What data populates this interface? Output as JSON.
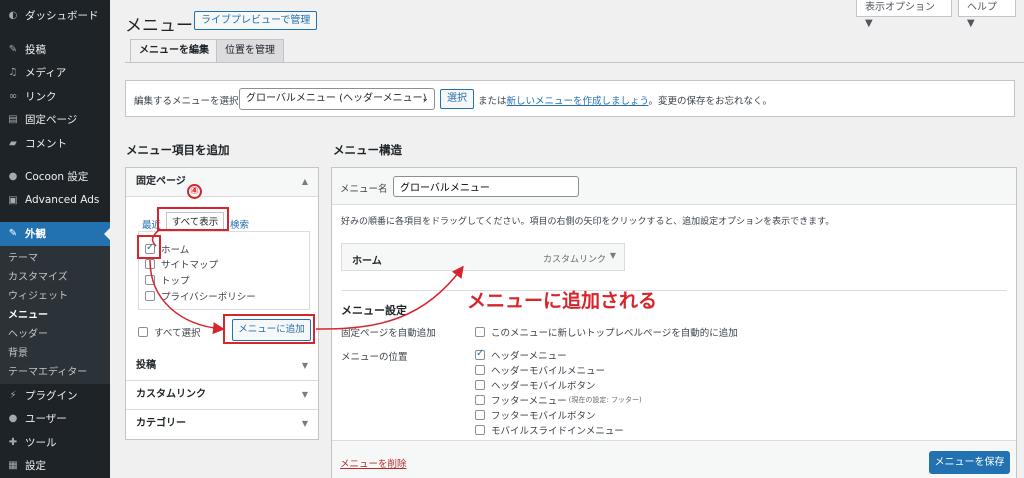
{
  "sidebar": {
    "items": [
      {
        "label": "ダッシュボード",
        "icon": "dashboard-icon"
      },
      {
        "label": "投稿",
        "icon": "pin-icon"
      },
      {
        "label": "メディア",
        "icon": "media-icon"
      },
      {
        "label": "リンク",
        "icon": "link-icon"
      },
      {
        "label": "固定ページ",
        "icon": "page-icon"
      },
      {
        "label": "コメント",
        "icon": "comment-icon"
      },
      {
        "label": "Cocoon 設定",
        "icon": "cocoon-icon"
      },
      {
        "label": "Advanced Ads",
        "icon": "ads-icon"
      },
      {
        "label": "外観",
        "icon": "brush-icon"
      },
      {
        "label": "プラグイン",
        "icon": "plugin-icon"
      },
      {
        "label": "ユーザー",
        "icon": "user-icon"
      },
      {
        "label": "ツール",
        "icon": "wrench-icon"
      },
      {
        "label": "設定",
        "icon": "settings-icon"
      }
    ],
    "submenu": [
      "テーマ",
      "カスタマイズ",
      "ウィジェット",
      "メニュー",
      "ヘッダー",
      "背景",
      "テーマエディター"
    ]
  },
  "header": {
    "title": "メニュー",
    "live_preview": "ライブプレビューで管理",
    "screen_options": "表示オプション ▼",
    "help": "ヘルプ ▼",
    "tabs": [
      "メニューを編集",
      "位置を管理"
    ]
  },
  "select_bar": {
    "label": "編集するメニューを選択:",
    "selected": "グローバルメニュー (ヘッダーメニュー)",
    "button": "選択",
    "note_prefix": "または",
    "note_link": "新しいメニューを作成しましょう",
    "note_suffix": "。変更の保存をお忘れなく。"
  },
  "add_items": {
    "title": "メニュー項目を追加",
    "fixed_pages": "固定ページ",
    "tabs": {
      "recent": "最近",
      "all": "すべて表示",
      "search": "検索"
    },
    "pages": [
      {
        "label": "ホーム",
        "checked": true
      },
      {
        "label": "サイトマップ",
        "checked": false
      },
      {
        "label": "トップ",
        "checked": false
      },
      {
        "label": "プライバシーポリシー",
        "checked": false
      }
    ],
    "select_all": "すべて選択",
    "add_button": "メニューに追加",
    "sections": [
      "投稿",
      "カスタムリンク",
      "カテゴリー"
    ]
  },
  "structure": {
    "title": "メニュー構造",
    "name_label": "メニュー名",
    "name_value": "グローバルメニュー",
    "instructions": "好みの順番に各項目をドラッグしてください。項目の右側の矢印をクリックすると、追加設定オプションを表示できます。",
    "item": {
      "title": "ホーム",
      "type": "カスタムリンク"
    },
    "settings_title": "メニュー設定",
    "auto_add_label": "固定ページを自動追加",
    "auto_add_option": "このメニューに新しいトップレベルページを自動的に追加",
    "location_label": "メニューの位置",
    "locations": [
      {
        "label": "ヘッダーメニュー",
        "note": "",
        "checked": true
      },
      {
        "label": "ヘッダーモバイルメニュー",
        "note": "",
        "checked": false
      },
      {
        "label": "ヘッダーモバイルボタン",
        "note": "",
        "checked": false
      },
      {
        "label": "フッターメニュー",
        "note": "(現在の設定: フッター)",
        "checked": false
      },
      {
        "label": "フッターモバイルボタン",
        "note": "",
        "checked": false
      },
      {
        "label": "モバイルスライドインメニュー",
        "note": "",
        "checked": false
      }
    ],
    "delete_link": "メニューを削除",
    "save_button": "メニューを保存"
  },
  "annotations": {
    "step_number": "④",
    "callout": "メニューに追加される",
    "color": "#d6252c"
  },
  "colors": {
    "accent": "#2271b1",
    "sidebar_bg": "#1d2327",
    "danger": "#b32d2e"
  }
}
